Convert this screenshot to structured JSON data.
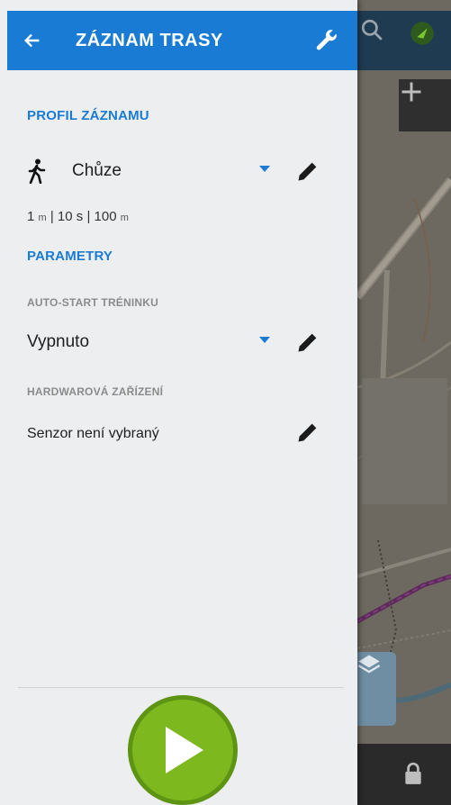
{
  "header": {
    "title": "ZÁZNAM TRASY"
  },
  "profile_section": {
    "title": "PROFIL ZÁZNAMU",
    "profile_name": "Chůze",
    "settings": {
      "dist_value": "1",
      "dist_unit": "m",
      "sep1": " | ",
      "time_value": "10 s",
      "sep2": " | ",
      "elev_value": "100",
      "elev_unit": "m"
    }
  },
  "parameters_section": {
    "title": "PARAMETRY",
    "autostart_label": "AUTO-START TRÉNINKU",
    "autostart_value": "Vypnuto",
    "hardware_label": "HARDWAROVÁ ZAŘÍZENÍ",
    "hardware_value": "Senzor není vybraný"
  },
  "colors": {
    "accent": "#1a7bd4",
    "play": "#7cb81e",
    "drawer_bg": "#eceeef"
  },
  "icons": [
    "back-arrow-icon",
    "wrench-icon",
    "walking-person-icon",
    "dropdown-arrow-icon",
    "pencil-icon",
    "play-icon",
    "search-icon",
    "gps-icon",
    "plus-icon",
    "layers-icon",
    "lock-icon"
  ]
}
